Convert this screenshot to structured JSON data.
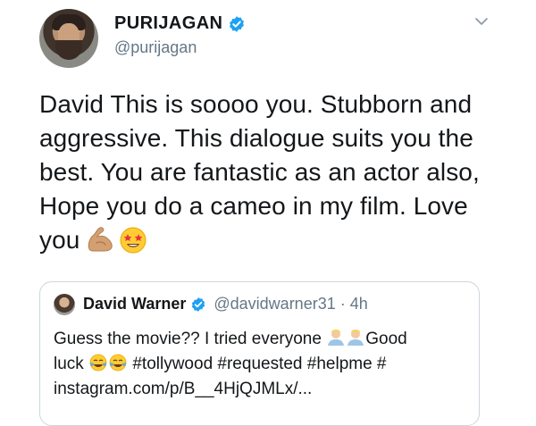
{
  "tweet": {
    "display_name": "PURIJAGAN",
    "handle": "@purijagan",
    "text": "David This is soooo you. Stubborn and aggressive. This dialogue suits you the best. You are fantastic as an actor also, Hope you do a cameo in my film. Love you",
    "trailing_emojis": [
      "flexed-biceps-icon",
      "star-struck-icon"
    ],
    "verified_icon": "verified-badge-icon",
    "menu_icon": "chevron-down-icon"
  },
  "quoted_tweet": {
    "display_name": "David Warner",
    "handle_time": "@davidwarner31 · 4h",
    "text_part1": "Guess the movie?? I tried everyone",
    "text_part2": "Good",
    "text_part3": "luck",
    "text_part4": "#tollywood #requested #helpme #",
    "text_part5": "instagram.com/p/B__4HjQJMLx/..."
  },
  "colors": {
    "accent": "#1da1f2",
    "text": "#14171a",
    "secondary": "#657786",
    "border": "#ccd6dd"
  }
}
